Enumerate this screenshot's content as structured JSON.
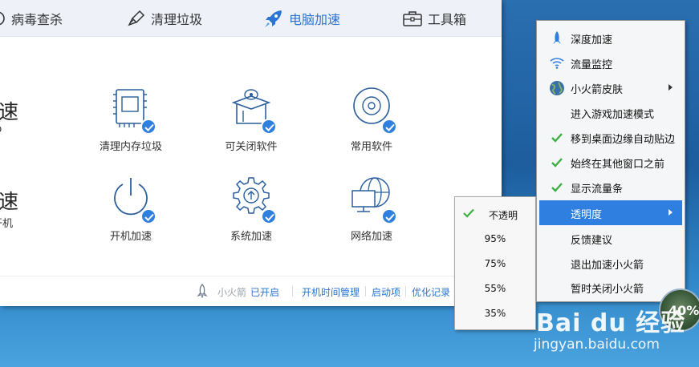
{
  "app": {
    "tabs": [
      {
        "label": "病毒查杀",
        "icon": "virus-scan-icon"
      },
      {
        "label": "清理垃圾",
        "icon": "broom-icon"
      },
      {
        "label": "电脑加速",
        "icon": "rocket-icon",
        "active": true
      },
      {
        "label": "工具箱",
        "icon": "toolbox-icon"
      }
    ],
    "left_clipped": {
      "row1_big": "速",
      "row1_small": "p",
      "row2_big": "速",
      "row2_small": "开机"
    },
    "tools": [
      {
        "label": "清理内存垃圾",
        "icon": "memory-chip-icon",
        "checked": true
      },
      {
        "label": "可关闭软件",
        "icon": "software-box-icon",
        "checked": true
      },
      {
        "label": "常用软件",
        "icon": "disc-icon",
        "checked": true
      },
      {
        "label": "开机加速",
        "icon": "power-icon",
        "checked": true
      },
      {
        "label": "系统加速",
        "icon": "gear-icon",
        "checked": true
      },
      {
        "label": "网络加速",
        "icon": "network-globe-icon",
        "checked": true
      }
    ],
    "bottom": {
      "rocket_label": "小火箭",
      "rocket_status": "已开启",
      "links": [
        "开机时间管理",
        "启动项",
        "优化记录"
      ]
    }
  },
  "context_menu": {
    "items": [
      {
        "label": "深度加速",
        "icon": "rocket-icon"
      },
      {
        "label": "流量监控",
        "icon": "wifi-icon"
      },
      {
        "label": "小火箭皮肤",
        "icon": "globe-icon",
        "submenu": true
      },
      {
        "label": "进入游戏加速模式"
      },
      {
        "label": "移到桌面边缘自动贴边",
        "checked": true
      },
      {
        "label": "始终在其他窗口之前",
        "checked": true
      },
      {
        "label": "显示流量条",
        "checked": true
      },
      {
        "label": "透明度",
        "submenu": true,
        "highlighted": true
      },
      {
        "label": "反馈建议"
      },
      {
        "label": "退出加速小火箭"
      },
      {
        "label": "暂时关闭小火箭"
      }
    ]
  },
  "opacity_submenu": {
    "items": [
      {
        "label": "不透明",
        "checked": true
      },
      {
        "label": "95%"
      },
      {
        "label": "75%"
      },
      {
        "label": "55%"
      },
      {
        "label": "35%"
      }
    ]
  },
  "gauge": {
    "value": "40%"
  },
  "watermark": {
    "logo": "Bai du 经验",
    "url": "jingyan.baidu.com"
  },
  "colors": {
    "accent": "#2f7fe0",
    "check_green": "#3cb043",
    "muted_gray": "#9aa4ae"
  }
}
